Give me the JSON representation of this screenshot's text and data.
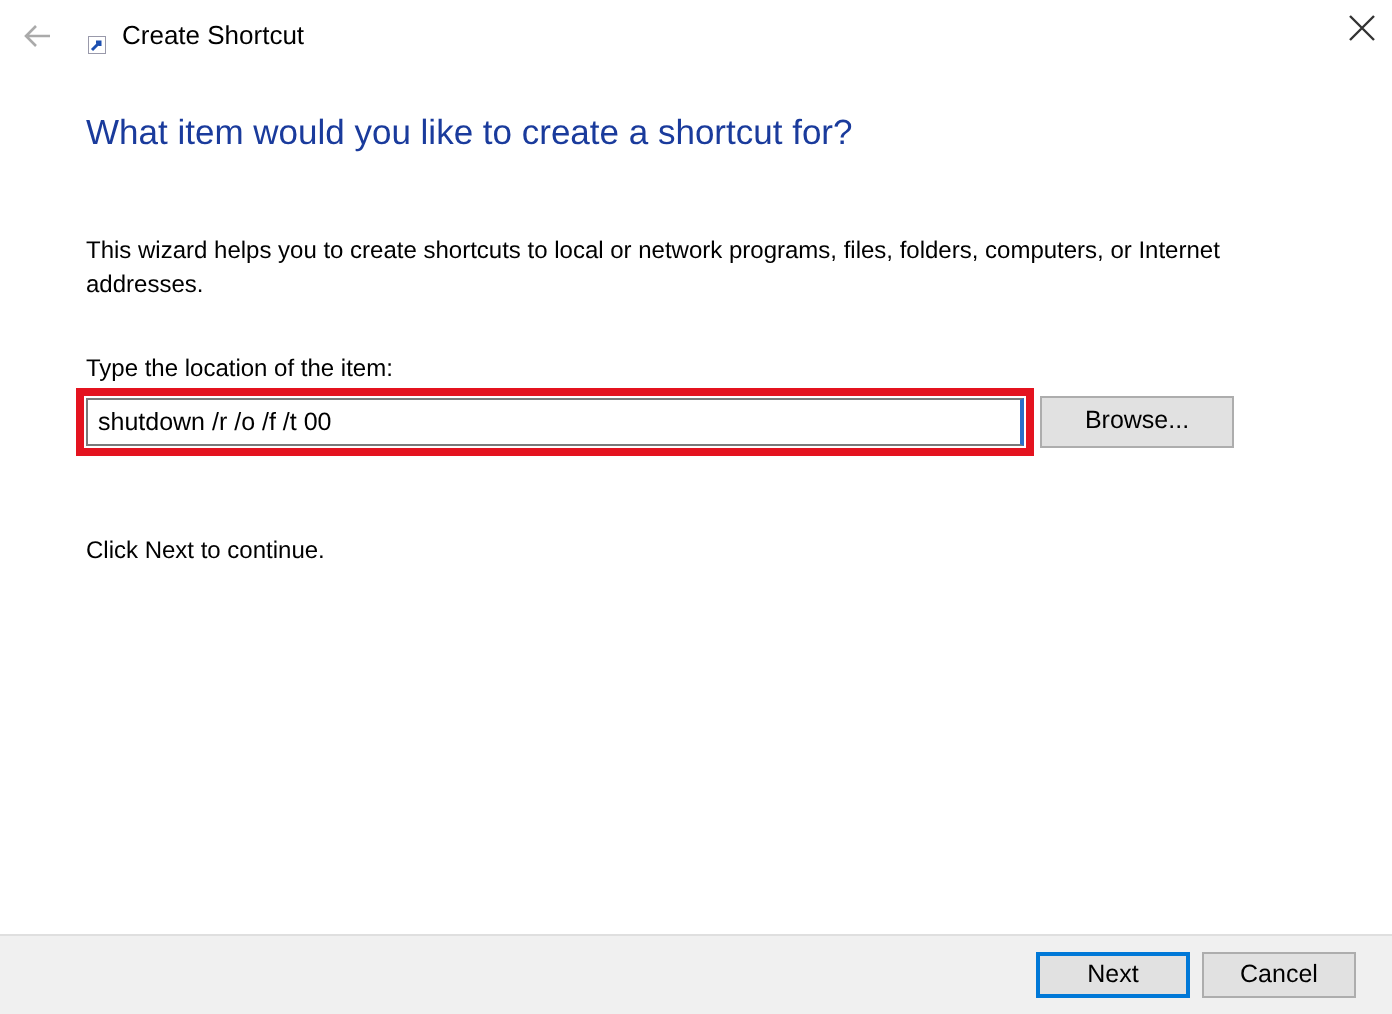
{
  "window": {
    "title": "Create Shortcut"
  },
  "heading": "What item would you like to create a shortcut for?",
  "intro": "This wizard helps you to create shortcuts to local or network programs, files, folders, computers, or Internet addresses.",
  "location": {
    "label": "Type the location of the item:",
    "value": "shutdown /r /o /f /t 00",
    "highlighted": true
  },
  "browse_button": "Browse...",
  "hint": "Click Next to continue.",
  "buttons": [
    {
      "label": "Next",
      "default": true
    },
    {
      "label": "Cancel",
      "default": false
    }
  ]
}
